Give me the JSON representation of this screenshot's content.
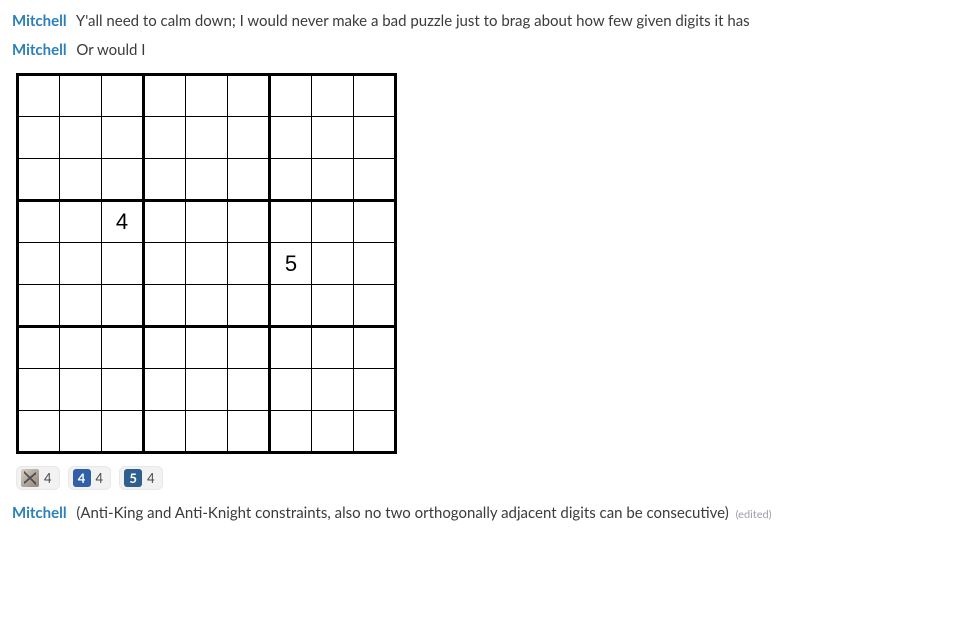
{
  "messages": [
    {
      "author": "Mitchell",
      "text": "Y'all need to calm down; I would never make a bad puzzle just to brag about how few given digits it has",
      "edited": false
    },
    {
      "author": "Mitchell",
      "text": "Or would I",
      "edited": false
    },
    {
      "author": "Mitchell",
      "text": "(Anti-King and Anti-Knight constraints, also no two orthogonally adjacent digits can be consecutive)",
      "edited": true
    }
  ],
  "edited_label": "(edited)",
  "sudoku": {
    "givens": [
      {
        "row": 4,
        "col": 3,
        "value": "4"
      },
      {
        "row": 5,
        "col": 7,
        "value": "5"
      }
    ]
  },
  "reactions": [
    {
      "kind": "avatar",
      "label": "",
      "bg": "",
      "count": "4"
    },
    {
      "kind": "numbox",
      "label": "4",
      "bg": "#3060a8",
      "count": "4"
    },
    {
      "kind": "numbox",
      "label": "5",
      "bg": "#2f5f8f",
      "count": "4"
    }
  ]
}
